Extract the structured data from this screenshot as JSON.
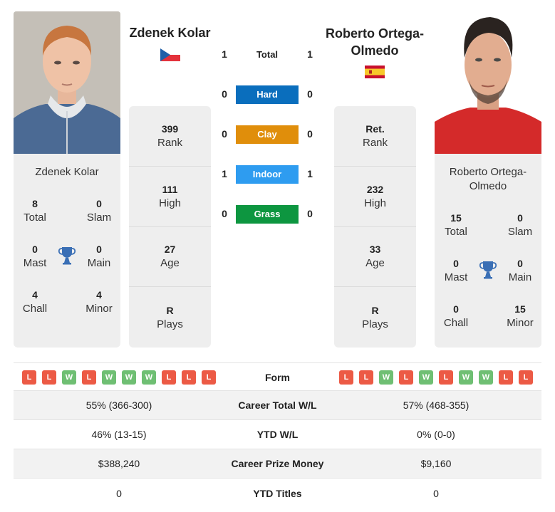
{
  "players": {
    "left": {
      "name": "Zdenek Kolar",
      "country": "Czech Republic",
      "flag_icon": "czech-flag",
      "card_name": "Zdenek Kolar",
      "titles": {
        "total": {
          "value": "8",
          "label": "Total"
        },
        "slam": {
          "value": "0",
          "label": "Slam"
        },
        "mast": {
          "value": "0",
          "label": "Mast"
        },
        "main": {
          "value": "0",
          "label": "Main"
        },
        "chall": {
          "value": "4",
          "label": "Chall"
        },
        "minor": {
          "value": "4",
          "label": "Minor"
        }
      },
      "stats": [
        {
          "value": "399",
          "label": "Rank"
        },
        {
          "value": "111",
          "label": "High"
        },
        {
          "value": "27",
          "label": "Age"
        },
        {
          "value": "R",
          "label": "Plays"
        }
      ],
      "form": [
        "L",
        "L",
        "W",
        "L",
        "W",
        "W",
        "W",
        "L",
        "L",
        "L"
      ]
    },
    "right": {
      "name": "Roberto Ortega-Olmedo",
      "name_line1": "Roberto Ortega-",
      "name_line2": "Olmedo",
      "country": "Spain",
      "flag_icon": "spain-flag",
      "card_name_line1": "Roberto Ortega-",
      "card_name_line2": "Olmedo",
      "titles": {
        "total": {
          "value": "15",
          "label": "Total"
        },
        "slam": {
          "value": "0",
          "label": "Slam"
        },
        "mast": {
          "value": "0",
          "label": "Mast"
        },
        "main": {
          "value": "0",
          "label": "Main"
        },
        "chall": {
          "value": "0",
          "label": "Chall"
        },
        "minor": {
          "value": "15",
          "label": "Minor"
        }
      },
      "stats": [
        {
          "value": "Ret.",
          "label": "Rank"
        },
        {
          "value": "232",
          "label": "High"
        },
        {
          "value": "33",
          "label": "Age"
        },
        {
          "value": "R",
          "label": "Plays"
        }
      ],
      "form": [
        "L",
        "L",
        "W",
        "L",
        "W",
        "L",
        "W",
        "W",
        "L",
        "L"
      ]
    }
  },
  "h2h": [
    {
      "label": "Total",
      "left": "1",
      "right": "1",
      "color": ""
    },
    {
      "label": "Hard",
      "left": "0",
      "right": "0",
      "color": "#0a6ebd"
    },
    {
      "label": "Clay",
      "left": "0",
      "right": "0",
      "color": "#e08e0b"
    },
    {
      "label": "Indoor",
      "left": "1",
      "right": "1",
      "color": "#2e9cf0"
    },
    {
      "label": "Grass",
      "left": "0",
      "right": "0",
      "color": "#0d9640"
    }
  ],
  "form_label": "Form",
  "comparison": [
    {
      "left": "55% (366-300)",
      "label": "Career Total W/L",
      "right": "57% (468-355)"
    },
    {
      "left": "46% (13-15)",
      "label": "YTD W/L",
      "right": "0% (0-0)"
    },
    {
      "left": "$388,240",
      "label": "Career Prize Money",
      "right": "$9,160"
    },
    {
      "left": "0",
      "label": "YTD Titles",
      "right": "0"
    }
  ],
  "colors": {
    "win": "#6fbf73",
    "loss": "#ec5a45",
    "trophy": "#3a6fb5",
    "card_bg": "#eeeeee"
  }
}
